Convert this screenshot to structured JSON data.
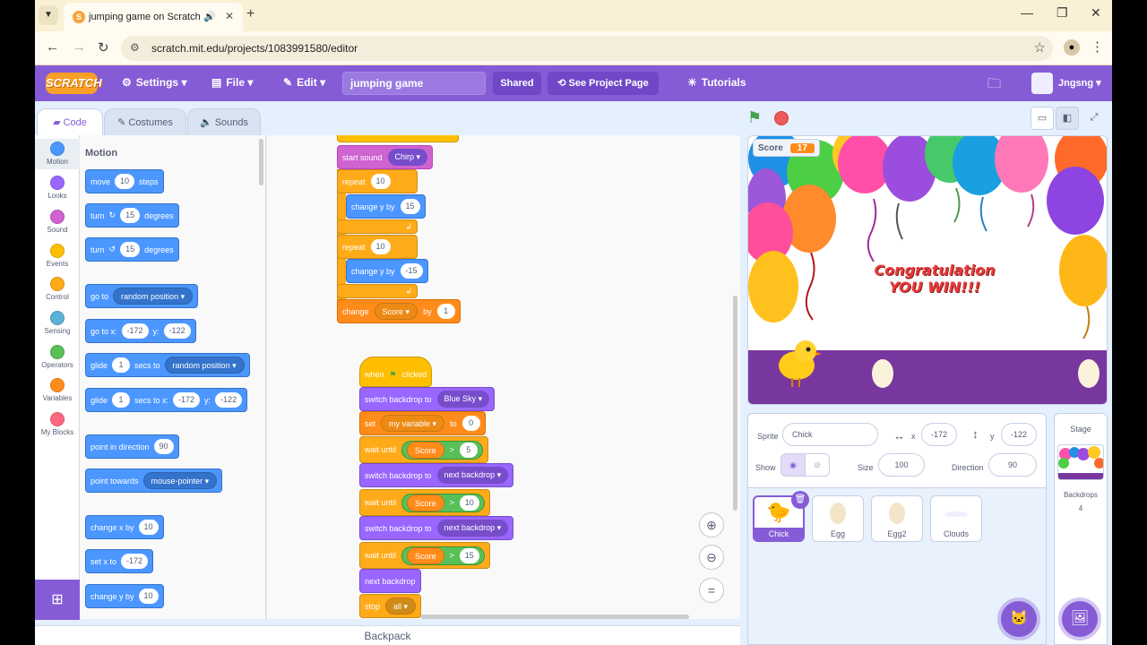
{
  "browser": {
    "tab_title": "jumping game on Scratch",
    "url": "scratch.mit.edu/projects/1083991580/editor"
  },
  "menubar": {
    "logo": "SCRATCH",
    "settings": "Settings",
    "file": "File",
    "edit": "Edit",
    "project_title": "jumping game",
    "shared": "Shared",
    "see_project_page": "See Project Page",
    "tutorials": "Tutorials",
    "username": "Jngsng"
  },
  "tabs": {
    "code": "Code",
    "costumes": "Costumes",
    "sounds": "Sounds"
  },
  "categories": [
    {
      "label": "Motion",
      "color": "#4c97ff"
    },
    {
      "label": "Looks",
      "color": "#9966ff"
    },
    {
      "label": "Sound",
      "color": "#cf63cf"
    },
    {
      "label": "Events",
      "color": "#ffbf00"
    },
    {
      "label": "Control",
      "color": "#ffab19"
    },
    {
      "label": "Sensing",
      "color": "#5cb1d6"
    },
    {
      "label": "Operators",
      "color": "#59c059"
    },
    {
      "label": "Variables",
      "color": "#ff8c1a"
    },
    {
      "label": "My Blocks",
      "color": "#ff6680"
    }
  ],
  "palette": {
    "title": "Motion",
    "move": {
      "a": "move",
      "v": "10",
      "b": "steps"
    },
    "turn_right": {
      "a": "turn",
      "v": "15",
      "b": "degrees"
    },
    "turn_left": {
      "a": "turn",
      "v": "15",
      "b": "degrees"
    },
    "goto": {
      "a": "go to",
      "dd": "random position"
    },
    "goto_xy": {
      "a": "go to x:",
      "x": "-172",
      "b": "y:",
      "y": "-122"
    },
    "glide_to": {
      "a": "glide",
      "v": "1",
      "b": "secs to",
      "dd": "random position"
    },
    "glide_xy": {
      "a": "glide",
      "v": "1",
      "b": "secs to x:",
      "x": "-172",
      "c": "y:",
      "y": "-122"
    },
    "point_dir": {
      "a": "point in direction",
      "v": "90"
    },
    "point_towards": {
      "a": "point towards",
      "dd": "mouse-pointer"
    },
    "change_x": {
      "a": "change x by",
      "v": "10"
    },
    "set_x": {
      "a": "set x to",
      "v": "-172"
    },
    "change_y": {
      "a": "change y by",
      "v": "10"
    }
  },
  "script1": {
    "start_sound": "start sound",
    "sound_name": "Chirp",
    "repeat1": "repeat",
    "repeat1_v": "10",
    "change_y1": "change y by",
    "change_y1_v": "15",
    "repeat2": "repeat",
    "repeat2_v": "10",
    "change_y2": "change y by",
    "change_y2_v": "-15",
    "change": "change",
    "var": "Score",
    "by": "by",
    "by_v": "1"
  },
  "script2": {
    "when": "when",
    "clicked": "clicked",
    "switch1": "switch backdrop to",
    "switch1_dd": "Blue Sky",
    "set": "set",
    "set_var": "my variable",
    "to": "to",
    "set_v": "0",
    "wait1": "wait until",
    "wait1_var": "Score",
    "wait1_op": ">",
    "wait1_v": "5",
    "switch2": "switch backdrop to",
    "switch2_dd": "next backdrop",
    "wait2": "wait until",
    "wait2_var": "Score",
    "wait2_op": ">",
    "wait2_v": "10",
    "switch3": "switch backdrop to",
    "switch3_dd": "next backdrop",
    "wait3": "wait until",
    "wait3_var": "Score",
    "wait3_op": ">",
    "wait3_v": "15",
    "next_backdrop": "next backdrop",
    "stop": "stop",
    "stop_dd": "all"
  },
  "backpack": "Backpack",
  "stage": {
    "monitor_label": "Score",
    "monitor_value": "17",
    "congrats_line1": "Congratulation",
    "congrats_line2": "YOU WIN!!!"
  },
  "sprite_info": {
    "sprite_label": "Sprite",
    "sprite_name": "Chick",
    "x_label": "x",
    "x": "-172",
    "y_label": "y",
    "y": "-122",
    "show_label": "Show",
    "size_label": "Size",
    "size": "100",
    "direction_label": "Direction",
    "direction": "90"
  },
  "sprites": [
    "Chick",
    "Egg",
    "Egg2",
    "Clouds"
  ],
  "stage_panel": {
    "title": "Stage",
    "backdrops_label": "Backdrops",
    "backdrops_count": "4"
  }
}
